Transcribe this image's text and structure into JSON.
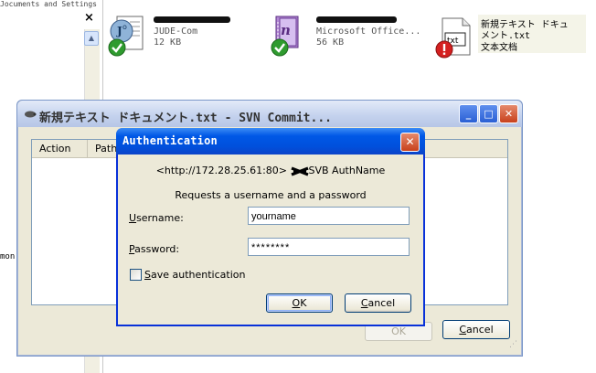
{
  "explorer": {
    "left_header": "Jocuments and Settings",
    "close_symbol": "×",
    "scroll_up_symbol": "▲",
    "cut_text": "mon:",
    "files": [
      {
        "name": "(redacted).jude",
        "type": "JUDE-Com",
        "size": "12 KB",
        "icon": "jude-document-icon",
        "overlay": "svn-normal-overlay-icon"
      },
      {
        "name": "(redacted)",
        "type": "Microsoft Office...",
        "size": "56 KB",
        "icon": "onenote-document-icon",
        "overlay": "svn-normal-overlay-icon"
      },
      {
        "name_line1": "新規テキスト ドキュ",
        "name_line2": "メント.txt",
        "type": "文本文档",
        "icon": "txt-document-icon",
        "icon_label": "txt",
        "overlay": "svn-conflict-overlay-icon"
      }
    ]
  },
  "commit_window": {
    "title": "新規テキスト ドキュメント.txt - SVN Commit...",
    "controls": {
      "minimize": "_",
      "maximize": "□",
      "close": "✕"
    },
    "columns": [
      "Action",
      "Path"
    ],
    "ok_label": "OK",
    "cancel_label": "Cancel",
    "grip": "⋰"
  },
  "auth_dialog": {
    "title": "Authentication",
    "close": "✕",
    "realm_prefix": "<http://172.28.25.61:80>",
    "realm_suffix": "SVB AuthName",
    "prompt": "Requests a username and a password",
    "username_label_u": "U",
    "username_label_rest": "sername:",
    "username_value": "yourname",
    "password_label_u": "P",
    "password_label_rest": "assword:",
    "password_value": "********",
    "save_u": "S",
    "save_rest": "ave authentication",
    "save_checked": false,
    "ok_u": "O",
    "ok_rest": "K",
    "cancel_u": "C",
    "cancel_rest": "ancel"
  },
  "colors": {
    "dialog_title": "#0054e3",
    "window_face": "#ece9d8",
    "close_button": "#d6532c"
  }
}
